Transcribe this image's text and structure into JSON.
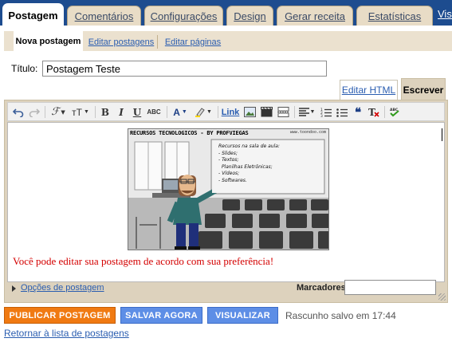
{
  "top_tabs": [
    {
      "label": "Postagem"
    },
    {
      "label": "Comentários"
    },
    {
      "label": "Configurações"
    },
    {
      "label": "Design"
    },
    {
      "label": "Gerar receita"
    },
    {
      "label": "Estatísticas"
    }
  ],
  "top_tabs_overflow": "Visu",
  "sub_tabs": [
    {
      "label": "Nova postagem"
    },
    {
      "label": "Editar postagens"
    },
    {
      "label": "Editar páginas"
    }
  ],
  "post": {
    "title_label": "Título:",
    "title_value": "Postagem Teste",
    "body_text": "Você pode editar sua postagem de acordo com sua preferência!"
  },
  "editor_modes": {
    "html": "Editar HTML",
    "compose": "Escrever"
  },
  "toolbar": {
    "undo_icon": "undo-icon",
    "redo_icon": "redo-icon",
    "font_label": "ℱ",
    "size_label": "тT",
    "bold": "B",
    "italic": "I",
    "underline": "U",
    "strike": "ABC",
    "text_color": "A",
    "link": "Link"
  },
  "image": {
    "caption": "RECURSOS TECNOLOGICOS  - BY PROFVIEGAS",
    "url": "www.toondoo.com",
    "board_lines": "Recursos na sala de aula:\n- Slides;\n- Textos;\n  Planilhas Eletrônicas;\n- Vídeos;\n- Softwares."
  },
  "options": {
    "link": "Opções de postagem",
    "labels": "Marcadores:"
  },
  "actions": {
    "publish": "PUBLICAR POSTAGEM",
    "save": "SALVAR AGORA",
    "preview": "VISUALIZAR"
  },
  "status": "Rascunho salvo em 17:44",
  "back_link": "Retornar à lista de postagens",
  "colors": {
    "nav_bg": "#1d4c8f",
    "tab_bg": "#e8dcc6",
    "publish": "#f07a12",
    "save": "#5d8ee6",
    "body_text": "#d40000"
  }
}
